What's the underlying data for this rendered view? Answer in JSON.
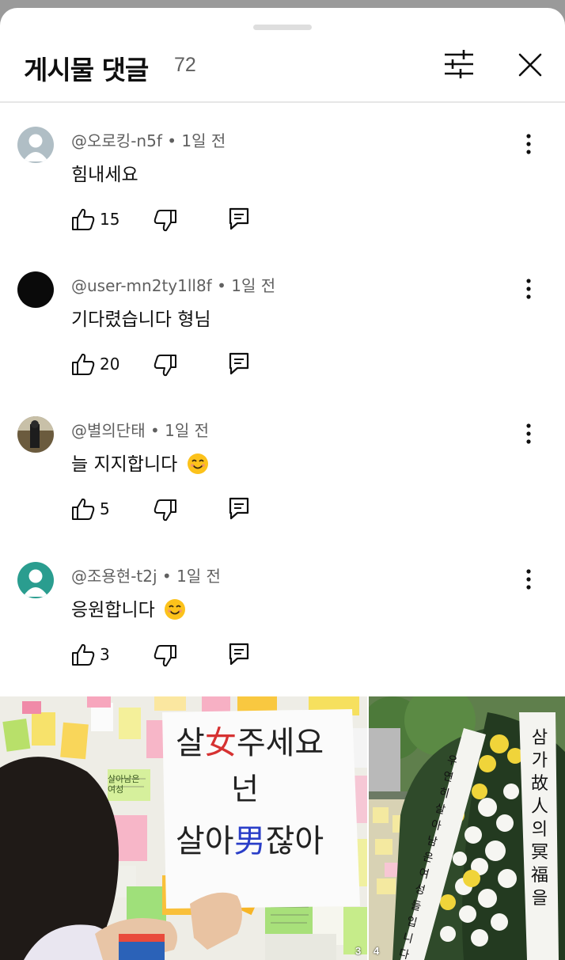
{
  "header": {
    "title": "게시물 댓글",
    "count": "72"
  },
  "comments": [
    {
      "author": "@오로킹-n5f",
      "time": "1일 전",
      "text": "힘내세요",
      "likes": "15",
      "avatar_color": "#b0bec5",
      "emoji": false
    },
    {
      "author": "@user-mn2ty1ll8f",
      "time": "1일 전",
      "text": "기다렸습니다 형님",
      "likes": "20",
      "avatar_color": "#0a0a0a",
      "emoji": false
    },
    {
      "author": "@별의단태",
      "time": "1일 전",
      "text": "늘 지지합니다",
      "likes": "5",
      "avatar_color": "#6b5b3e",
      "emoji": true
    },
    {
      "author": "@조용현-t2j",
      "time": "1일 전",
      "text": "응원합니다",
      "likes": "3",
      "avatar_color": "#2a9d8f",
      "emoji": true
    }
  ],
  "images": [
    {
      "badge": "3",
      "sign": {
        "line1a": "살",
        "line1b": "女",
        "line1c": "주세요",
        "line2": "넌",
        "line3a": "살아",
        "line3b": "男",
        "line3c": "잖아"
      },
      "note": "살아남은 여성"
    },
    {
      "badge": "4",
      "ribbon_right": "삼가 故人의 冥福을",
      "ribbon_left": "우연히 살아남은 여성들입니다"
    }
  ],
  "icons": [
    "filter-icon",
    "close-icon",
    "more-vert-icon",
    "thumb-up-icon",
    "thumb-down-icon",
    "reply-icon",
    "smile-emoji"
  ]
}
